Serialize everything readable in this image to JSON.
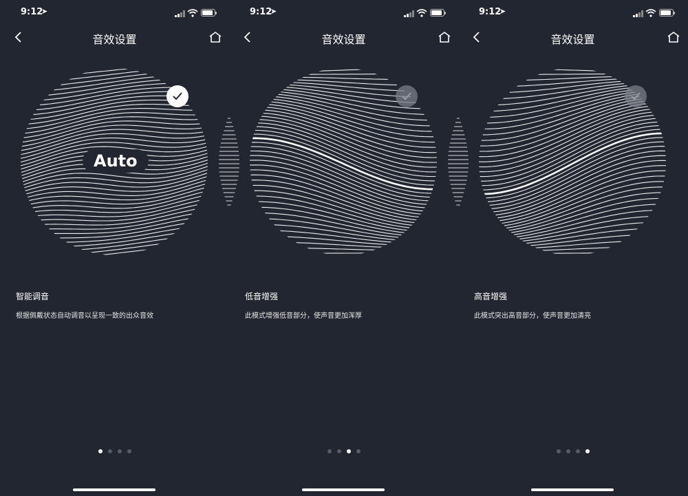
{
  "panels": [
    {
      "status": {
        "time": "9:12",
        "location_icon": "location-arrow-icon"
      },
      "nav": {
        "title": "音效设置"
      },
      "mode": {
        "id": "auto",
        "badge": "Auto",
        "name": "智能调音",
        "description": "根据佩戴状态自动调音以呈现一致的出众音效",
        "selected": true
      },
      "pagination": {
        "count": 4,
        "active": 0
      }
    },
    {
      "status": {
        "time": "9:12",
        "location_icon": "location-arrow-icon"
      },
      "nav": {
        "title": "音效设置"
      },
      "mode": {
        "id": "bass",
        "name": "低音增强",
        "description": "此模式增强低音部分，使声音更加浑厚",
        "selected": false
      },
      "pagination": {
        "count": 4,
        "active": 2
      }
    },
    {
      "status": {
        "time": "9:12",
        "location_icon": "location-arrow-icon"
      },
      "nav": {
        "title": "音效设置"
      },
      "mode": {
        "id": "treble",
        "name": "高音增强",
        "description": "此模式突出高音部分，使声音更加清亮",
        "selected": false
      },
      "pagination": {
        "count": 4,
        "active": 3
      }
    }
  ],
  "colors": {
    "background": "#212630",
    "foreground": "#ffffff",
    "dot_inactive": "#565c67"
  }
}
